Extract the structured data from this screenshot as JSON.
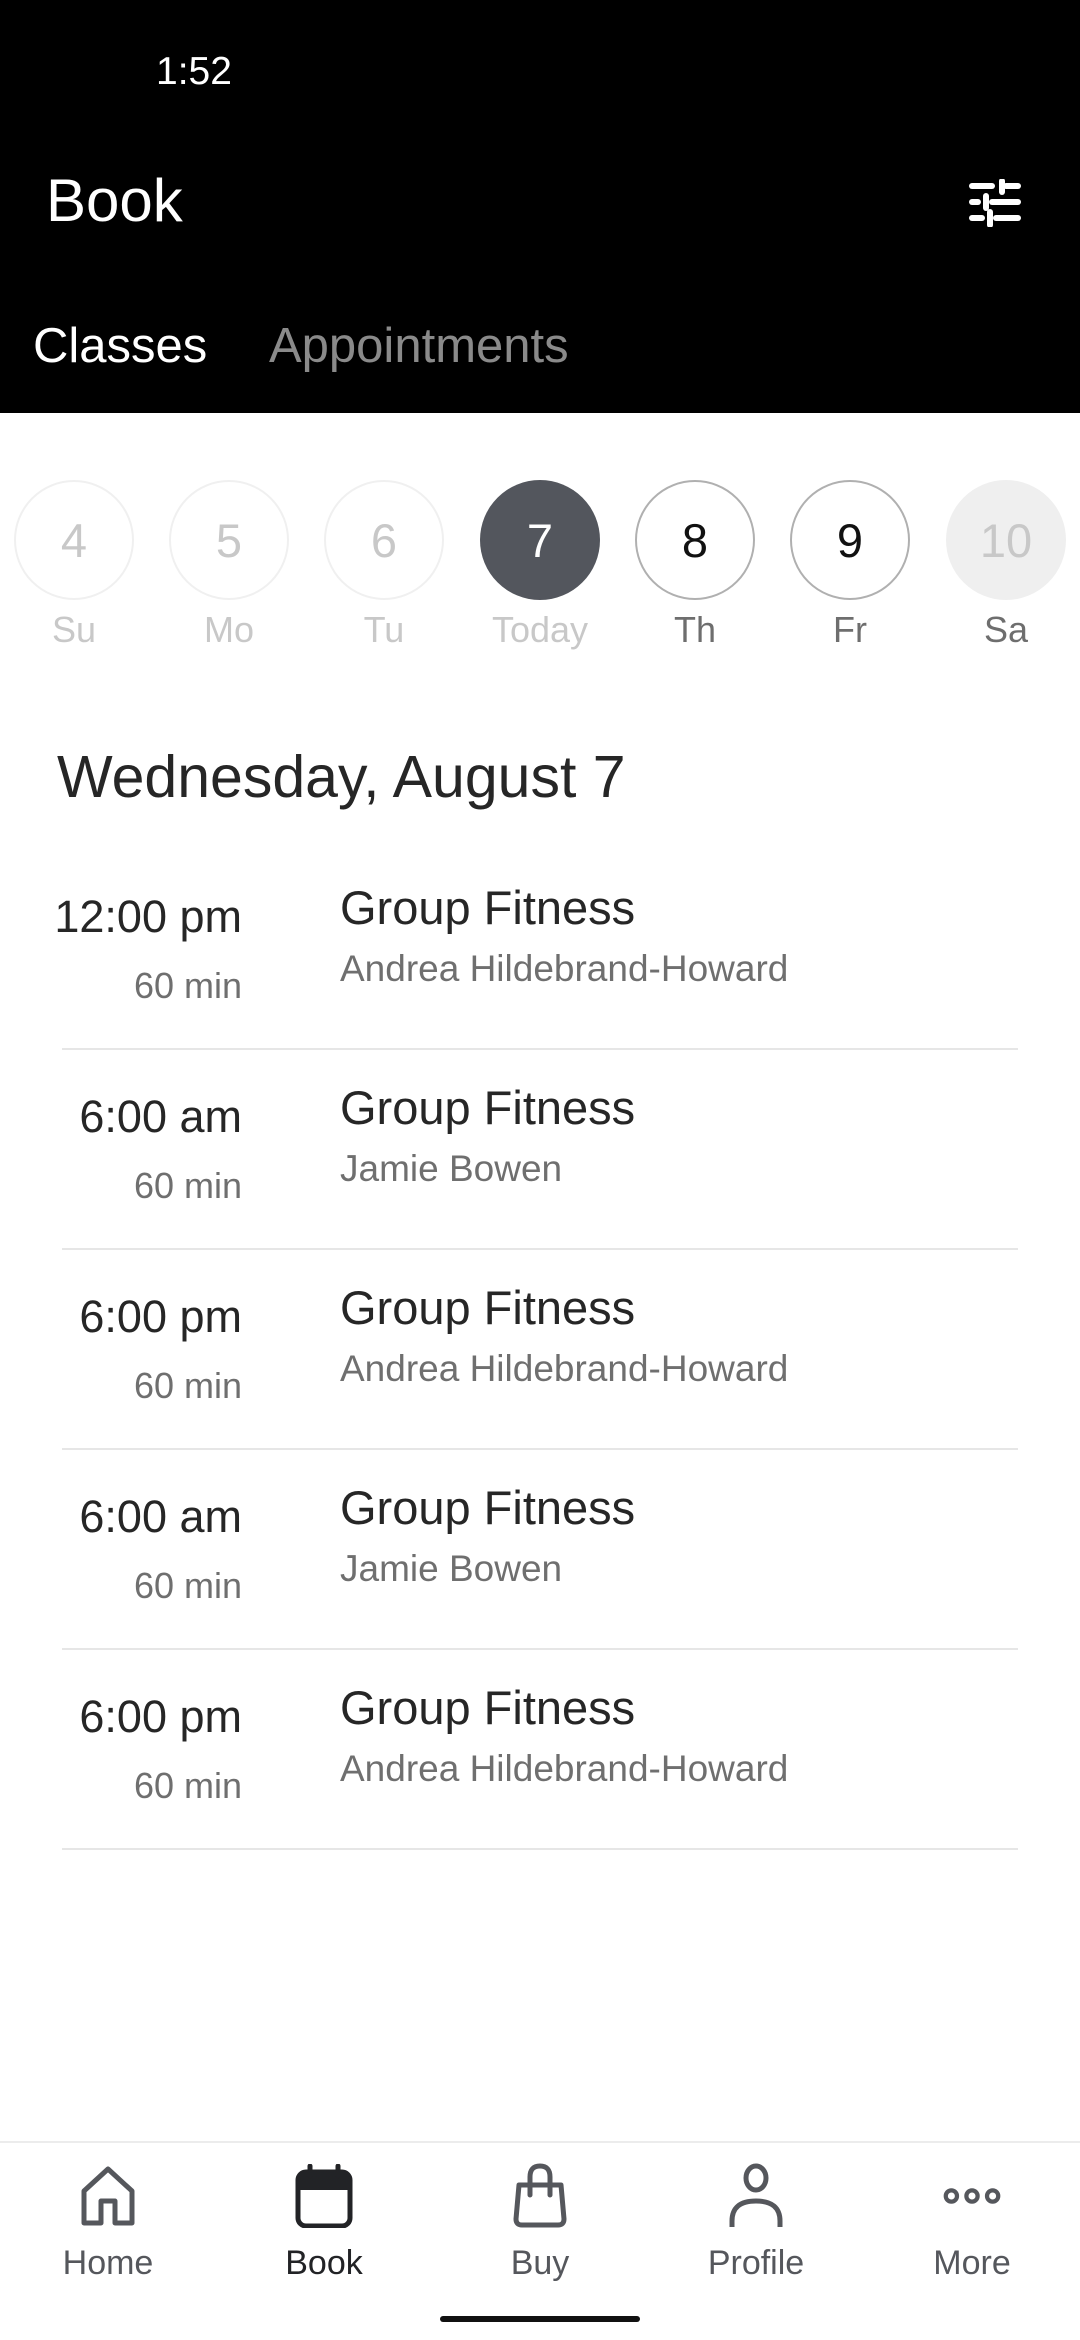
{
  "status_bar": {
    "time": "1:52"
  },
  "header": {
    "title": "Book",
    "filter_icon": "sliders-icon",
    "tabs": [
      {
        "label": "Classes",
        "active": true
      },
      {
        "label": "Appointments",
        "active": false
      }
    ]
  },
  "date_strip": {
    "days": [
      {
        "number": "4",
        "label": "Su",
        "state": "past"
      },
      {
        "number": "5",
        "label": "Mo",
        "state": "past"
      },
      {
        "number": "6",
        "label": "Tu",
        "state": "past"
      },
      {
        "number": "7",
        "label": "Today",
        "state": "selected"
      },
      {
        "number": "8",
        "label": "Th",
        "state": "future"
      },
      {
        "number": "9",
        "label": "Fr",
        "state": "future"
      },
      {
        "number": "10",
        "label": "Sa",
        "state": "disabled"
      }
    ],
    "selected_color": "#53565d"
  },
  "schedule": {
    "heading": "Wednesday, August 7",
    "classes": [
      {
        "time": "12:00 pm",
        "duration": "60 min",
        "name": "Group Fitness",
        "instructor": "Andrea Hildebrand-Howard"
      },
      {
        "time": "6:00 am",
        "duration": "60 min",
        "name": "Group Fitness",
        "instructor": "Jamie Bowen"
      },
      {
        "time": "6:00 pm",
        "duration": "60 min",
        "name": "Group Fitness",
        "instructor": "Andrea Hildebrand-Howard"
      },
      {
        "time": "6:00 am",
        "duration": "60 min",
        "name": "Group Fitness",
        "instructor": "Jamie Bowen"
      },
      {
        "time": "6:00 pm",
        "duration": "60 min",
        "name": "Group Fitness",
        "instructor": "Andrea Hildebrand-Howard"
      }
    ]
  },
  "bottom_nav": {
    "items": [
      {
        "label": "Home",
        "icon": "home-icon",
        "active": false
      },
      {
        "label": "Book",
        "icon": "calendar-icon",
        "active": true
      },
      {
        "label": "Buy",
        "icon": "shopping-bag-icon",
        "active": false
      },
      {
        "label": "Profile",
        "icon": "person-icon",
        "active": false
      },
      {
        "label": "More",
        "icon": "more-dots-icon",
        "active": false
      }
    ]
  }
}
